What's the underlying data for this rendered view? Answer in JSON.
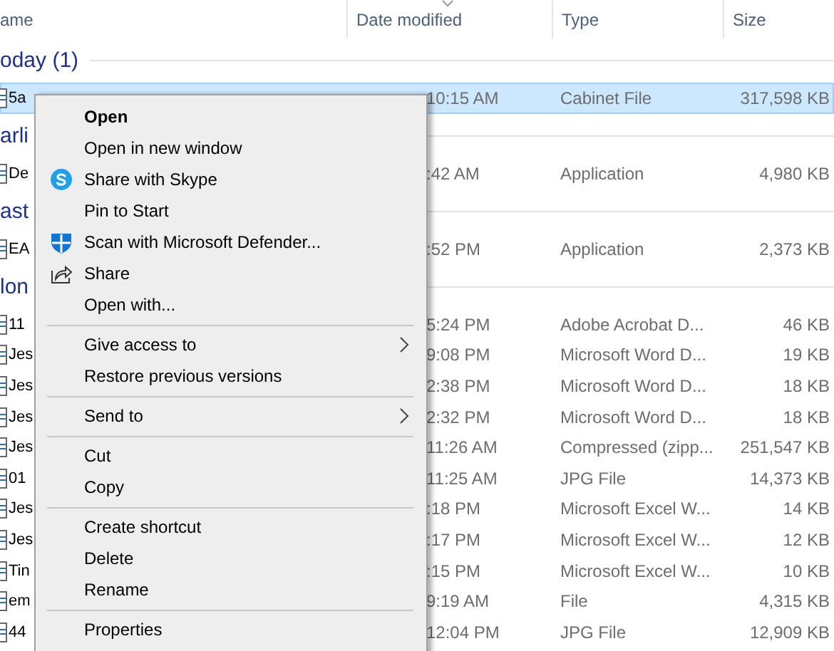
{
  "columns": [
    {
      "label": "ame"
    },
    {
      "label": "Date modified"
    },
    {
      "label": "Type"
    },
    {
      "label": "Size"
    }
  ],
  "groups": [
    {
      "title": "oday (1)",
      "rows": [
        {
          "name": "5a",
          "date": "10:15 AM",
          "type": "Cabinet File",
          "size": "317,598 KB",
          "selected": true
        }
      ]
    },
    {
      "title": "arli",
      "rows": [
        {
          "name": "De",
          "date": ":42 AM",
          "type": "Application",
          "size": "4,980 KB",
          "selected": false
        }
      ]
    },
    {
      "title": "ast",
      "rows": [
        {
          "name": "EA",
          "date": ":52 PM",
          "type": "Application",
          "size": "2,373 KB",
          "selected": false
        }
      ]
    },
    {
      "title": "lon",
      "rows": [
        {
          "name": "11",
          "date": "5:24 PM",
          "type": "Adobe Acrobat D...",
          "size": "46 KB",
          "selected": false
        },
        {
          "name": "Jes",
          "date": "9:08 PM",
          "type": "Microsoft Word D...",
          "size": "19 KB",
          "selected": false
        },
        {
          "name": "Jes",
          "date": "2:38 PM",
          "type": "Microsoft Word D...",
          "size": "18 KB",
          "selected": false
        },
        {
          "name": "Jes",
          "date": "2:32 PM",
          "type": "Microsoft Word D...",
          "size": "18 KB",
          "selected": false
        },
        {
          "name": "Jes",
          "date": "11:26 AM",
          "type": "Compressed (zipp...",
          "size": "251,547 KB",
          "selected": false
        },
        {
          "name": "01",
          "date": "11:25 AM",
          "type": "JPG File",
          "size": "14,373 KB",
          "selected": false
        },
        {
          "name": "Jes",
          "date": ":18 PM",
          "type": "Microsoft Excel W...",
          "size": "14 KB",
          "selected": false
        },
        {
          "name": "Jes",
          "date": ":17 PM",
          "type": "Microsoft Excel W...",
          "size": "12 KB",
          "selected": false
        },
        {
          "name": "Tin",
          "date": ":15 PM",
          "type": "Microsoft Excel W...",
          "size": "10 KB",
          "selected": false
        },
        {
          "name": "em",
          "date": "9:19 AM",
          "type": "File",
          "size": "4,315 KB",
          "selected": false
        },
        {
          "name": "44",
          "date": "12:04 PM",
          "type": "JPG File",
          "size": "12,909 KB",
          "selected": false
        }
      ]
    }
  ],
  "context_menu": [
    {
      "kind": "item",
      "label": "Open",
      "default": true
    },
    {
      "kind": "item",
      "label": "Open in new window"
    },
    {
      "kind": "item",
      "label": "Share with Skype"
    },
    {
      "kind": "item",
      "label": "Pin to Start"
    },
    {
      "kind": "item",
      "label": "Scan with Microsoft Defender..."
    },
    {
      "kind": "item",
      "label": "Share"
    },
    {
      "kind": "item",
      "label": "Open with..."
    },
    {
      "kind": "separator"
    },
    {
      "kind": "item",
      "label": "Give access to",
      "submenu": true
    },
    {
      "kind": "item",
      "label": "Restore previous versions"
    },
    {
      "kind": "separator"
    },
    {
      "kind": "item",
      "label": "Send to",
      "submenu": true
    },
    {
      "kind": "separator"
    },
    {
      "kind": "item",
      "label": "Cut"
    },
    {
      "kind": "item",
      "label": "Copy"
    },
    {
      "kind": "separator"
    },
    {
      "kind": "item",
      "label": "Create shortcut"
    },
    {
      "kind": "item",
      "label": "Delete"
    },
    {
      "kind": "item",
      "label": "Rename"
    },
    {
      "kind": "separator"
    },
    {
      "kind": "item",
      "label": "Properties"
    }
  ]
}
